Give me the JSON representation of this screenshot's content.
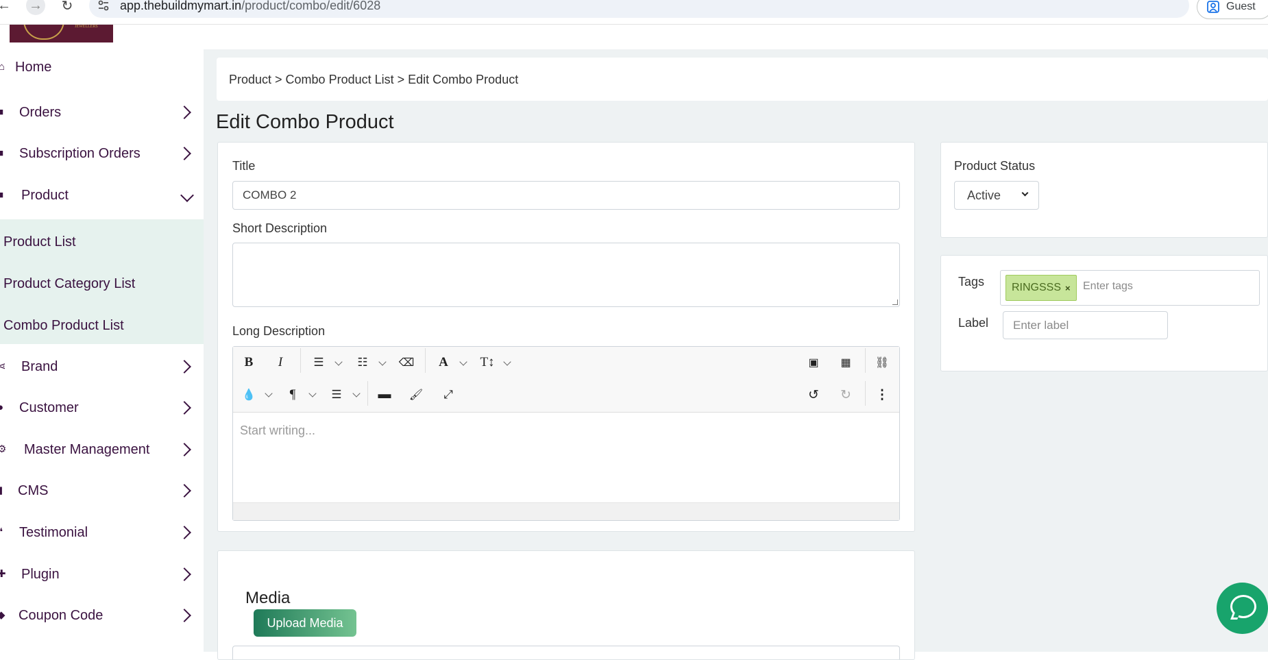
{
  "browser": {
    "url_host": "app.thebuildmymart.in",
    "url_path": "/product/combo/edit/6028",
    "profile_label": "Guest"
  },
  "sidebar": {
    "items": [
      {
        "label": "Home",
        "icon": "home-icon"
      },
      {
        "label": "Orders",
        "icon": "shopping-bag-icon"
      },
      {
        "label": "Subscription Orders",
        "icon": "shopping-bag-icon"
      },
      {
        "label": "Product",
        "icon": "archive-icon"
      },
      {
        "label": "Brand",
        "icon": "share-icon"
      },
      {
        "label": "Customer",
        "icon": "user-icon"
      },
      {
        "label": "Master Management",
        "icon": "users-cog-icon"
      },
      {
        "label": "CMS",
        "icon": "file-icon"
      },
      {
        "label": "Testimonial",
        "icon": "quote-icon"
      },
      {
        "label": "Plugin",
        "icon": "plug-icon"
      },
      {
        "label": "Coupon Code",
        "icon": "tag-icon"
      }
    ],
    "product_submenu": [
      {
        "label": "Product List"
      },
      {
        "label": "Product Category List"
      },
      {
        "label": "Combo Product List"
      }
    ]
  },
  "breadcrumb": "Product > Combo Product List > Edit Combo Product",
  "page_title": "Edit Combo Product",
  "form": {
    "title_label": "Title",
    "title_value": "COMBO 2",
    "short_desc_label": "Short Description",
    "short_desc_value": "",
    "long_desc_label": "Long Description",
    "editor_placeholder": "Start writing..."
  },
  "status": {
    "label": "Product Status",
    "selected": "Active"
  },
  "tags": {
    "label": "Tags",
    "items": [
      "RINGSSS"
    ],
    "remove_glyph": "×",
    "placeholder": "Enter tags"
  },
  "label_field": {
    "label": "Label",
    "placeholder": "Enter label"
  },
  "media": {
    "title": "Media",
    "upload_label": "Upload Media"
  },
  "colors": {
    "sidebar_text": "#3a1240",
    "submenu_bg": "#e6f2ee",
    "main_bg": "#eef2f3",
    "tag_bg": "#c7e59a",
    "upload_btn": "#1f7a58",
    "chat_btn": "#18a46c"
  }
}
